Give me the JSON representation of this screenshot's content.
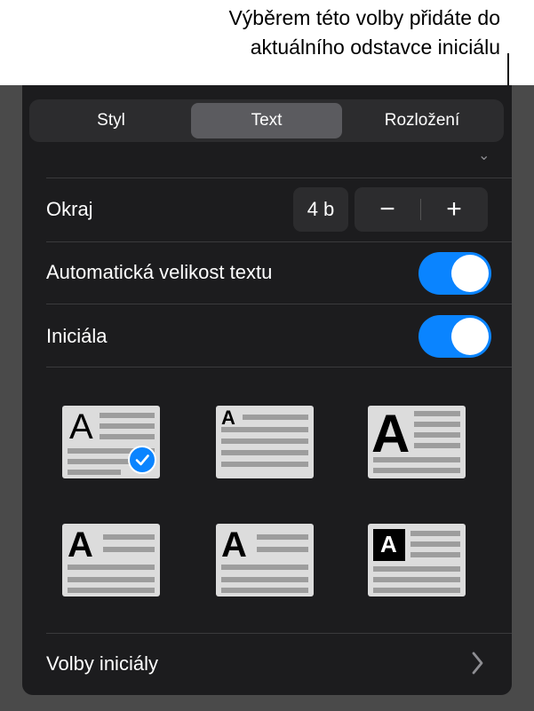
{
  "callout": {
    "line1": "Výběrem této volby přidáte do",
    "line2": "aktuálního odstavce iniciálu"
  },
  "tabs": [
    {
      "label": "Styl"
    },
    {
      "label": "Text"
    },
    {
      "label": "Rozložení"
    }
  ],
  "selected_tab": "Text",
  "okraj": {
    "label": "Okraj",
    "value": "4 b",
    "minus": "−",
    "plus": "+"
  },
  "auto_size": {
    "label": "Automatická velikost textu",
    "on": true
  },
  "initial": {
    "label": "Iniciála",
    "on": true
  },
  "tiles": [
    {
      "letter": "A",
      "selected": true
    },
    {
      "letter": "A"
    },
    {
      "letter": "A"
    },
    {
      "letter": "A"
    },
    {
      "letter": "A"
    },
    {
      "letter": "A"
    }
  ],
  "options": {
    "label": "Volby iniciály"
  },
  "colors": {
    "accent": "#0a84ff",
    "panel": "#1c1c1e",
    "control": "#2c2c2e"
  }
}
